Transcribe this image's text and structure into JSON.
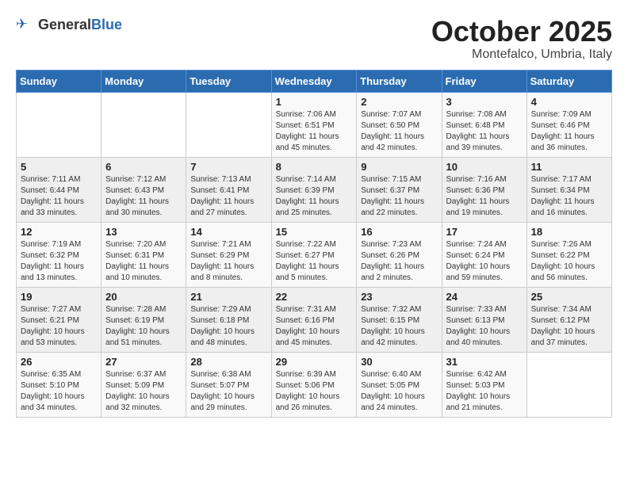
{
  "header": {
    "logo_general": "General",
    "logo_blue": "Blue",
    "month": "October 2025",
    "location": "Montefalco, Umbria, Italy"
  },
  "days_of_week": [
    "Sunday",
    "Monday",
    "Tuesday",
    "Wednesday",
    "Thursday",
    "Friday",
    "Saturday"
  ],
  "weeks": [
    [
      {
        "day": "",
        "content": ""
      },
      {
        "day": "",
        "content": ""
      },
      {
        "day": "",
        "content": ""
      },
      {
        "day": "1",
        "content": "Sunrise: 7:06 AM\nSunset: 6:51 PM\nDaylight: 11 hours and 45 minutes."
      },
      {
        "day": "2",
        "content": "Sunrise: 7:07 AM\nSunset: 6:50 PM\nDaylight: 11 hours and 42 minutes."
      },
      {
        "day": "3",
        "content": "Sunrise: 7:08 AM\nSunset: 6:48 PM\nDaylight: 11 hours and 39 minutes."
      },
      {
        "day": "4",
        "content": "Sunrise: 7:09 AM\nSunset: 6:46 PM\nDaylight: 11 hours and 36 minutes."
      }
    ],
    [
      {
        "day": "5",
        "content": "Sunrise: 7:11 AM\nSunset: 6:44 PM\nDaylight: 11 hours and 33 minutes."
      },
      {
        "day": "6",
        "content": "Sunrise: 7:12 AM\nSunset: 6:43 PM\nDaylight: 11 hours and 30 minutes."
      },
      {
        "day": "7",
        "content": "Sunrise: 7:13 AM\nSunset: 6:41 PM\nDaylight: 11 hours and 27 minutes."
      },
      {
        "day": "8",
        "content": "Sunrise: 7:14 AM\nSunset: 6:39 PM\nDaylight: 11 hours and 25 minutes."
      },
      {
        "day": "9",
        "content": "Sunrise: 7:15 AM\nSunset: 6:37 PM\nDaylight: 11 hours and 22 minutes."
      },
      {
        "day": "10",
        "content": "Sunrise: 7:16 AM\nSunset: 6:36 PM\nDaylight: 11 hours and 19 minutes."
      },
      {
        "day": "11",
        "content": "Sunrise: 7:17 AM\nSunset: 6:34 PM\nDaylight: 11 hours and 16 minutes."
      }
    ],
    [
      {
        "day": "12",
        "content": "Sunrise: 7:19 AM\nSunset: 6:32 PM\nDaylight: 11 hours and 13 minutes."
      },
      {
        "day": "13",
        "content": "Sunrise: 7:20 AM\nSunset: 6:31 PM\nDaylight: 11 hours and 10 minutes."
      },
      {
        "day": "14",
        "content": "Sunrise: 7:21 AM\nSunset: 6:29 PM\nDaylight: 11 hours and 8 minutes."
      },
      {
        "day": "15",
        "content": "Sunrise: 7:22 AM\nSunset: 6:27 PM\nDaylight: 11 hours and 5 minutes."
      },
      {
        "day": "16",
        "content": "Sunrise: 7:23 AM\nSunset: 6:26 PM\nDaylight: 11 hours and 2 minutes."
      },
      {
        "day": "17",
        "content": "Sunrise: 7:24 AM\nSunset: 6:24 PM\nDaylight: 10 hours and 59 minutes."
      },
      {
        "day": "18",
        "content": "Sunrise: 7:26 AM\nSunset: 6:22 PM\nDaylight: 10 hours and 56 minutes."
      }
    ],
    [
      {
        "day": "19",
        "content": "Sunrise: 7:27 AM\nSunset: 6:21 PM\nDaylight: 10 hours and 53 minutes."
      },
      {
        "day": "20",
        "content": "Sunrise: 7:28 AM\nSunset: 6:19 PM\nDaylight: 10 hours and 51 minutes."
      },
      {
        "day": "21",
        "content": "Sunrise: 7:29 AM\nSunset: 6:18 PM\nDaylight: 10 hours and 48 minutes."
      },
      {
        "day": "22",
        "content": "Sunrise: 7:31 AM\nSunset: 6:16 PM\nDaylight: 10 hours and 45 minutes."
      },
      {
        "day": "23",
        "content": "Sunrise: 7:32 AM\nSunset: 6:15 PM\nDaylight: 10 hours and 42 minutes."
      },
      {
        "day": "24",
        "content": "Sunrise: 7:33 AM\nSunset: 6:13 PM\nDaylight: 10 hours and 40 minutes."
      },
      {
        "day": "25",
        "content": "Sunrise: 7:34 AM\nSunset: 6:12 PM\nDaylight: 10 hours and 37 minutes."
      }
    ],
    [
      {
        "day": "26",
        "content": "Sunrise: 6:35 AM\nSunset: 5:10 PM\nDaylight: 10 hours and 34 minutes."
      },
      {
        "day": "27",
        "content": "Sunrise: 6:37 AM\nSunset: 5:09 PM\nDaylight: 10 hours and 32 minutes."
      },
      {
        "day": "28",
        "content": "Sunrise: 6:38 AM\nSunset: 5:07 PM\nDaylight: 10 hours and 29 minutes."
      },
      {
        "day": "29",
        "content": "Sunrise: 6:39 AM\nSunset: 5:06 PM\nDaylight: 10 hours and 26 minutes."
      },
      {
        "day": "30",
        "content": "Sunrise: 6:40 AM\nSunset: 5:05 PM\nDaylight: 10 hours and 24 minutes."
      },
      {
        "day": "31",
        "content": "Sunrise: 6:42 AM\nSunset: 5:03 PM\nDaylight: 10 hours and 21 minutes."
      },
      {
        "day": "",
        "content": ""
      }
    ]
  ]
}
